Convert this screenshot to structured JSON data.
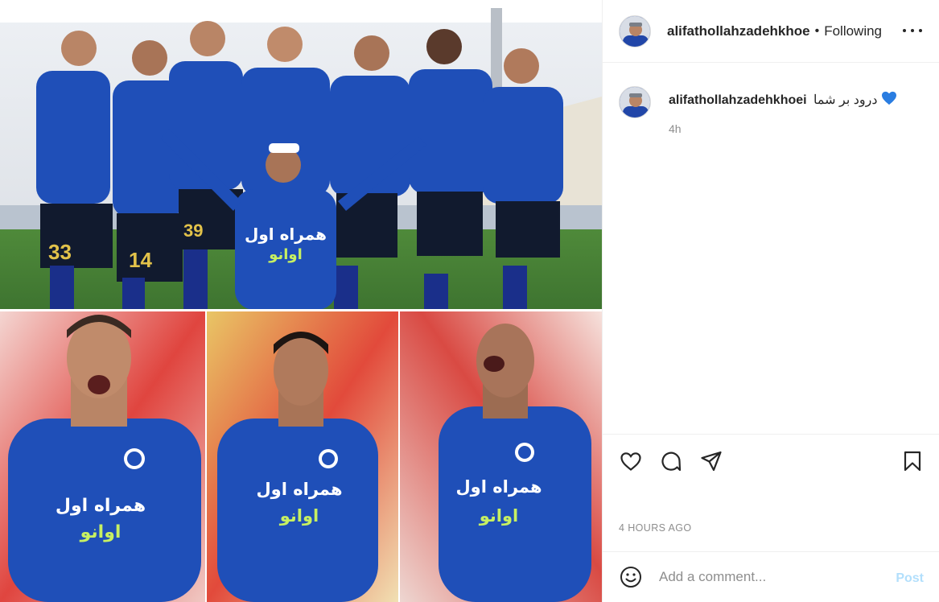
{
  "post": {
    "author": "alifathollahzadehkhoe",
    "separator": "•",
    "follow_status": "Following",
    "more_label": "More options"
  },
  "caption": {
    "username": "alifathollahzadehkhoei",
    "text": "درود بر شما",
    "emoji": "blue-heart",
    "age": "4h"
  },
  "actions": {
    "like": "like-icon",
    "comment": "comment-icon",
    "share": "share-icon",
    "save": "save-icon"
  },
  "timestamp": "4 HOURS AGO",
  "comment_box": {
    "placeholder": "Add a comment...",
    "post_label": "Post"
  },
  "photo": {
    "jersey_numbers": [
      "33",
      "14",
      "39"
    ],
    "sponsor_text": "همراه اول",
    "sponsor_text_2": "اوانو"
  },
  "colors": {
    "accent_link": "#b2dffc",
    "jersey_blue": "#1f4fb8",
    "muted": "#8e8e8e"
  }
}
